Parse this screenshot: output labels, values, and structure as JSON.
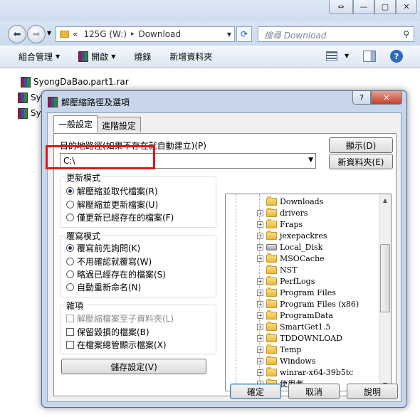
{
  "explorer": {
    "address": {
      "drive": "125G (W:)",
      "folder": "Download",
      "prefix": "«",
      "sep": "▸"
    },
    "search_placeholder": "搜尋 Download",
    "toolbar": [
      {
        "label": "組合管理",
        "arrow": "▼"
      },
      {
        "label": "開啟",
        "arrow": "▼"
      },
      {
        "label": "燒錄",
        "arrow": ""
      },
      {
        "label": "新增資料夾",
        "arrow": ""
      }
    ],
    "files": [
      "SyongDaBao.part1.rar",
      "Sy",
      "Sy"
    ]
  },
  "dialog": {
    "title": "解壓縮路徑及選項",
    "tabs": [
      "一般設定",
      "進階設定"
    ],
    "dest_label": "目的地路徑(如果不存在就自動建立)(P)",
    "dest_value": "C:\\",
    "show_button": "顯示(D)",
    "newfolder_button": "新資料夾(E)",
    "update_mode": {
      "title": "更新模式",
      "options": [
        "解壓縮並取代檔案(R)",
        "解壓縮並更新檔案(U)",
        "僅更新已經存在的檔案(F)"
      ]
    },
    "overwrite_mode": {
      "title": "覆寫模式",
      "options": [
        "覆寫前先詢問(K)",
        "不用確認就覆寫(W)",
        "略過已經存在的檔案(S)",
        "自動重新命名(N)"
      ]
    },
    "misc": {
      "title": "雜項",
      "options": [
        "解壓縮檔案至子資料夾(L)",
        "保留毀損的檔案(B)",
        "在檔案總管顯示檔案(X)"
      ]
    },
    "save_button": "儲存設定(V)",
    "tree": [
      "Downloads",
      "drivers",
      "Fraps",
      "jexepackres",
      "Local_Disk",
      "MSOCache",
      "NST",
      "PerfLogs",
      "Program Files",
      "Program Files (x86)",
      "ProgramData",
      "SmartGet1.5",
      "TDDOWNLOAD",
      "Temp",
      "Windows",
      "winrar-x64-39b5tc",
      "使用者"
    ],
    "ok_button": "確定",
    "cancel_button": "取消",
    "help_button": "說明"
  }
}
